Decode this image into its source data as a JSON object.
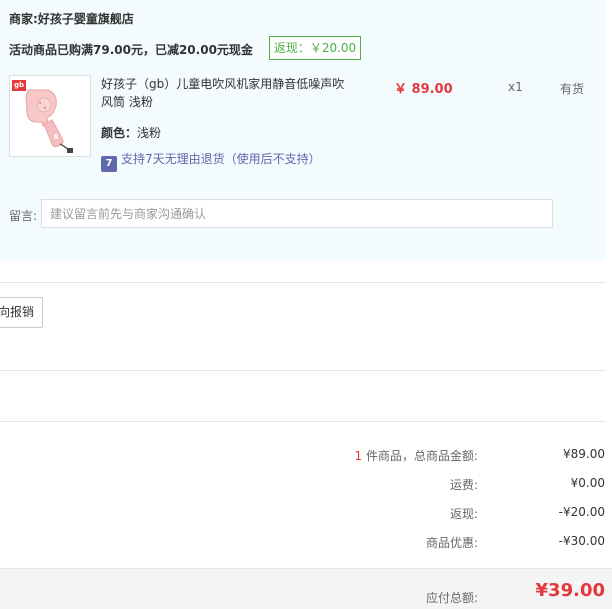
{
  "merchant": {
    "label": "商家:",
    "name": "好孩子婴童旗舰店"
  },
  "promo": {
    "text": "活动商品已购满79.00元，已减20.00元现金",
    "badge": "返现：￥20.00"
  },
  "item": {
    "name": "好孩子（gb）儿童电吹风机家用静音低噪声吹风筒 浅粉",
    "price": "￥ 89.00",
    "quantity": "x1",
    "stock": "有货",
    "color_label": "颜色：",
    "color_value": "浅粉",
    "return_icon": "7",
    "return_text": "支持7天无理由退货（使用后不支持）",
    "thumb_logo": "gb"
  },
  "note": {
    "label": "留言:",
    "placeholder": "建议留言前先与商家沟通确认"
  },
  "reimburse_button": "向报销",
  "summary": {
    "count": "1",
    "goods_label": " 件商品，总商品金额:",
    "goods_value": "¥89.00",
    "shipping_label": "运费:",
    "shipping_value": "¥0.00",
    "rebate_label": "返现:",
    "rebate_value": "-¥20.00",
    "discount_label": "商品优惠:",
    "discount_value": "-¥30.00"
  },
  "total": {
    "label": "应付总额:",
    "value": "¥39.00"
  },
  "colors": {
    "accent_red": "#e4393c",
    "green": "#4ab344",
    "panel_bg": "#f3fbfe",
    "link_blue": "#5e69ad"
  }
}
